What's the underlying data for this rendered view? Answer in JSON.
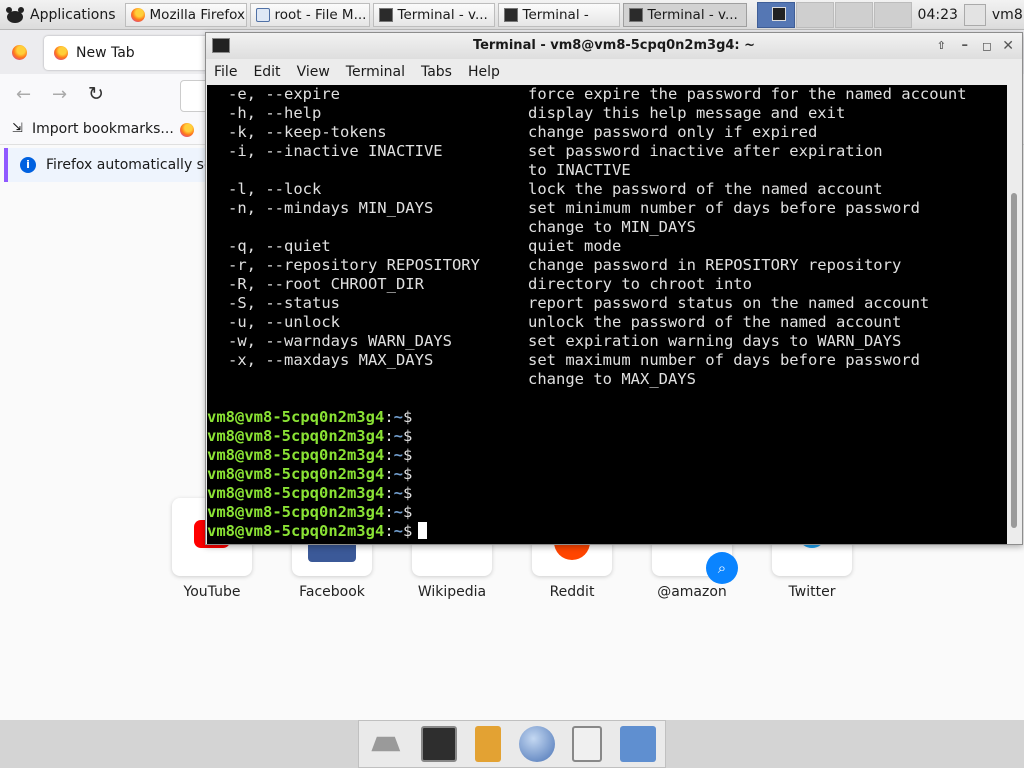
{
  "top_panel": {
    "applications_label": "Applications",
    "tasks": [
      {
        "label": "Mozilla Firefox",
        "icon": "firefox-icon"
      },
      {
        "label": "root - File M...",
        "icon": "file-manager-icon"
      },
      {
        "label": "Terminal - v...",
        "icon": "terminal-icon"
      },
      {
        "label": "Terminal -",
        "icon": "terminal-icon"
      },
      {
        "label": "Terminal - v...",
        "icon": "terminal-icon",
        "active": true
      }
    ],
    "clock": "04:23",
    "user": "vm8"
  },
  "firefox": {
    "tab_title": "New Tab",
    "import_bookmarks": "Import bookmarks...",
    "notice_text": "Firefox automatically se",
    "shortcuts": [
      "YouTube",
      "Facebook",
      "Wikipedia",
      "Reddit",
      "@amazon",
      "Twitter"
    ]
  },
  "terminal": {
    "title": "Terminal - vm8@vm8-5cpq0n2m3g4: ~",
    "menu": [
      "File",
      "Edit",
      "View",
      "Terminal",
      "Tabs",
      "Help"
    ],
    "lines": [
      {
        "opt": "-e, --expire",
        "desc": "force expire the password for the named account"
      },
      {
        "opt": "-h, --help",
        "desc": "display this help message and exit"
      },
      {
        "opt": "-k, --keep-tokens",
        "desc": "change password only if expired"
      },
      {
        "opt": "-i, --inactive INACTIVE",
        "desc": "set password inactive after expiration"
      },
      {
        "opt": "",
        "desc": "to INACTIVE"
      },
      {
        "opt": "-l, --lock",
        "desc": "lock the password of the named account"
      },
      {
        "opt": "-n, --mindays MIN_DAYS",
        "desc": "set minimum number of days before password"
      },
      {
        "opt": "",
        "desc": "change to MIN_DAYS"
      },
      {
        "opt": "-q, --quiet",
        "desc": "quiet mode"
      },
      {
        "opt": "-r, --repository REPOSITORY",
        "desc": "change password in REPOSITORY repository"
      },
      {
        "opt": "-R, --root CHROOT_DIR",
        "desc": "directory to chroot into"
      },
      {
        "opt": "-S, --status",
        "desc": "report password status on the named account"
      },
      {
        "opt": "-u, --unlock",
        "desc": "unlock the password of the named account"
      },
      {
        "opt": "-w, --warndays WARN_DAYS",
        "desc": "set expiration warning days to WARN_DAYS"
      },
      {
        "opt": "-x, --maxdays MAX_DAYS",
        "desc": "set maximum number of days before password"
      },
      {
        "opt": "",
        "desc": "change to MAX_DAYS"
      }
    ],
    "prompt_user": "vm8@vm8-5cpq0n2m3g4",
    "prompt_sep": ":",
    "prompt_path": "~",
    "prompt_end": "$",
    "prompt_count": 7
  }
}
